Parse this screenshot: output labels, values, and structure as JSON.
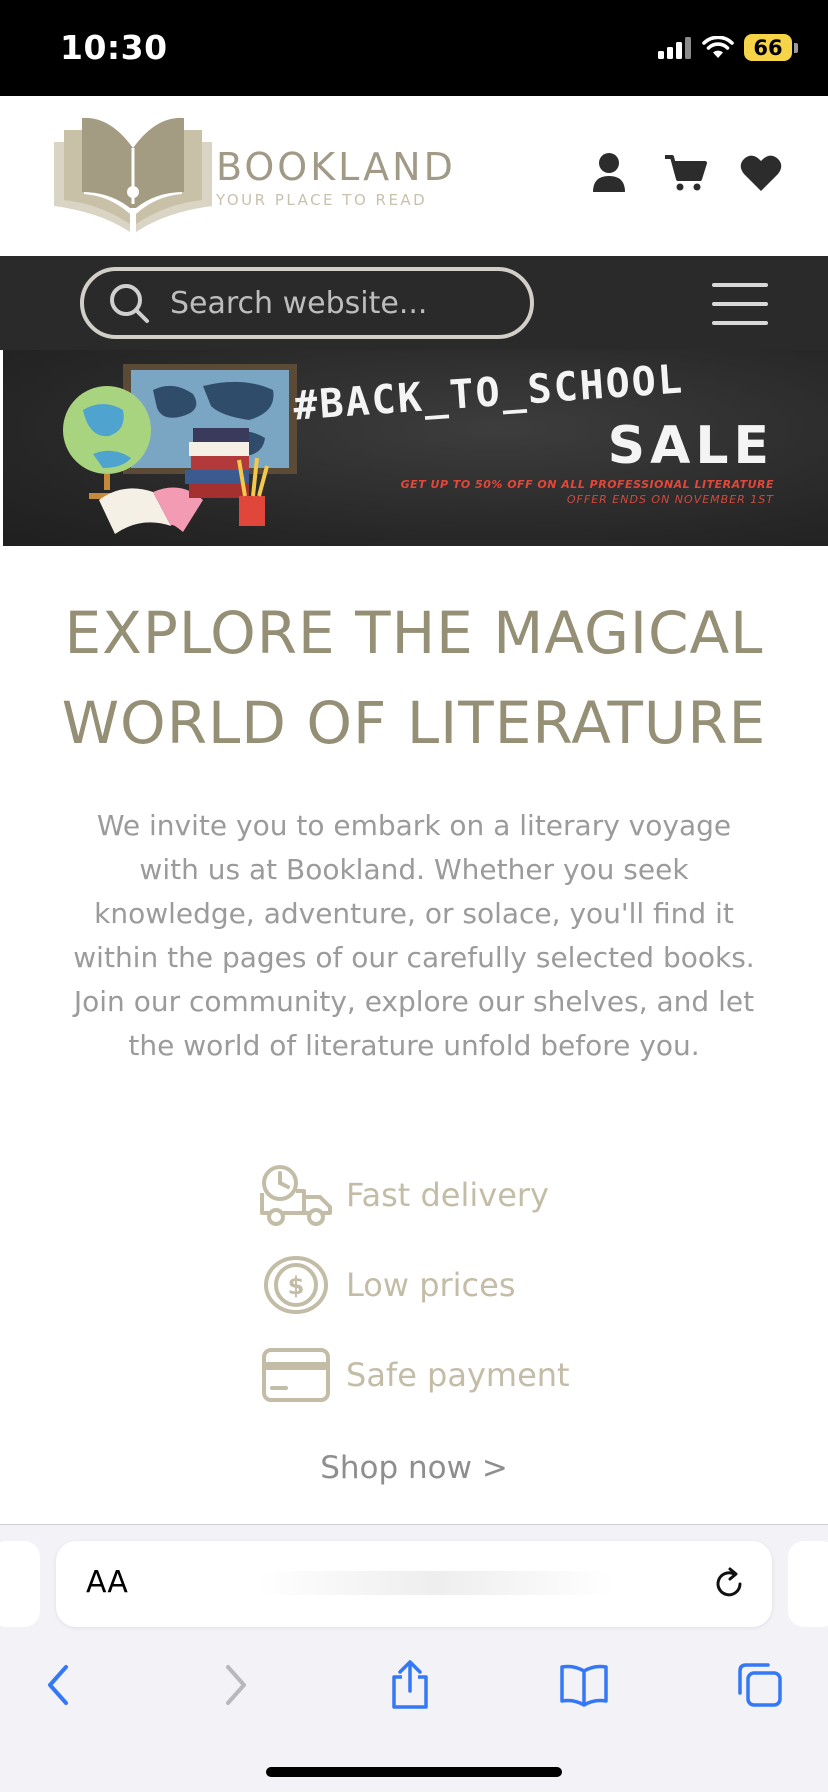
{
  "status_bar": {
    "time": "10:30",
    "battery": "66"
  },
  "header": {
    "brand_name": "BOOKLAND",
    "tagline": "YOUR PLACE TO READ",
    "icons": [
      "user-icon",
      "cart-icon",
      "heart-icon"
    ]
  },
  "search": {
    "placeholder": "Search website..."
  },
  "banner": {
    "hashtag": "#BACK_TO_SCHOOL",
    "sale": "SALE",
    "offer": "GET UP TO 50% OFF ON ALL PROFESSIONAL LITERATURE",
    "ends": "OFFER ENDS ON NOVEMBER 1ST"
  },
  "hero": {
    "title_line1": "EXPLORE THE MAGICAL",
    "title_line2": "WORLD OF LITERATURE",
    "text": "We invite you to embark on a literary voyage with us at Bookland. Whether you seek knowledge, adventure, or solace, you'll find it within the pages of our carefully selected books. Join our community, explore our shelves, and let the world of literature unfold before you."
  },
  "features": [
    {
      "label": "Fast delivery",
      "icon": "delivery-truck-icon"
    },
    {
      "label": "Low prices",
      "icon": "dollar-coin-icon"
    },
    {
      "label": "Safe payment",
      "icon": "credit-card-icon"
    }
  ],
  "shop_now": "Shop now >",
  "safari": {
    "aa_label": "AA",
    "toolbar_icons": [
      "back-icon",
      "forward-icon",
      "share-icon",
      "bookmarks-icon",
      "tabs-icon"
    ]
  },
  "colors": {
    "brand": "#958f76",
    "brand_light": "#c3bda7",
    "dark_bar": "#2a2a2b",
    "battery": "#f5d547",
    "safari_blue": "#3478f6"
  }
}
